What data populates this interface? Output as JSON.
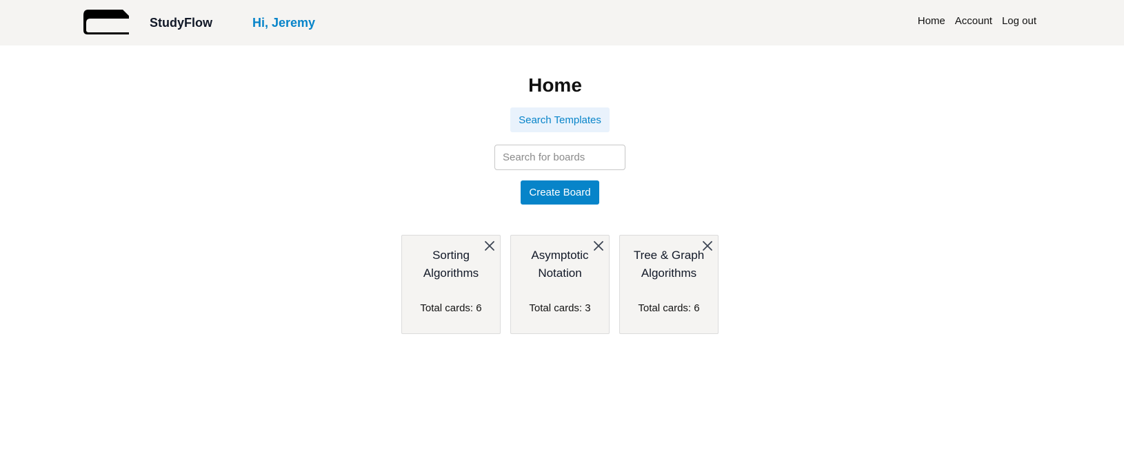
{
  "header": {
    "brand": "StudyFlow",
    "greeting": "Hi, Jeremy",
    "logo_icon": "book-icon",
    "nav": [
      {
        "label": "Home"
      },
      {
        "label": "Account"
      },
      {
        "label": "Log out"
      }
    ]
  },
  "main": {
    "title": "Home",
    "templates_button": "Search Templates",
    "search_placeholder": "Search for boards",
    "search_value": "",
    "create_button": "Create Board"
  },
  "boards": [
    {
      "title": "Sorting Algorithms",
      "count_label": "Total cards: ",
      "count": "6"
    },
    {
      "title": "Asymptotic Notation",
      "count_label": "Total cards: ",
      "count": "3"
    },
    {
      "title": "Tree & Graph Algorithms",
      "count_label": "Total cards: ",
      "count": "6"
    }
  ],
  "colors": {
    "accent": "#0784c9",
    "header_bg": "#f5f4f2",
    "card_bg": "#f5f4f2",
    "templates_bg": "#e9f2fc"
  }
}
